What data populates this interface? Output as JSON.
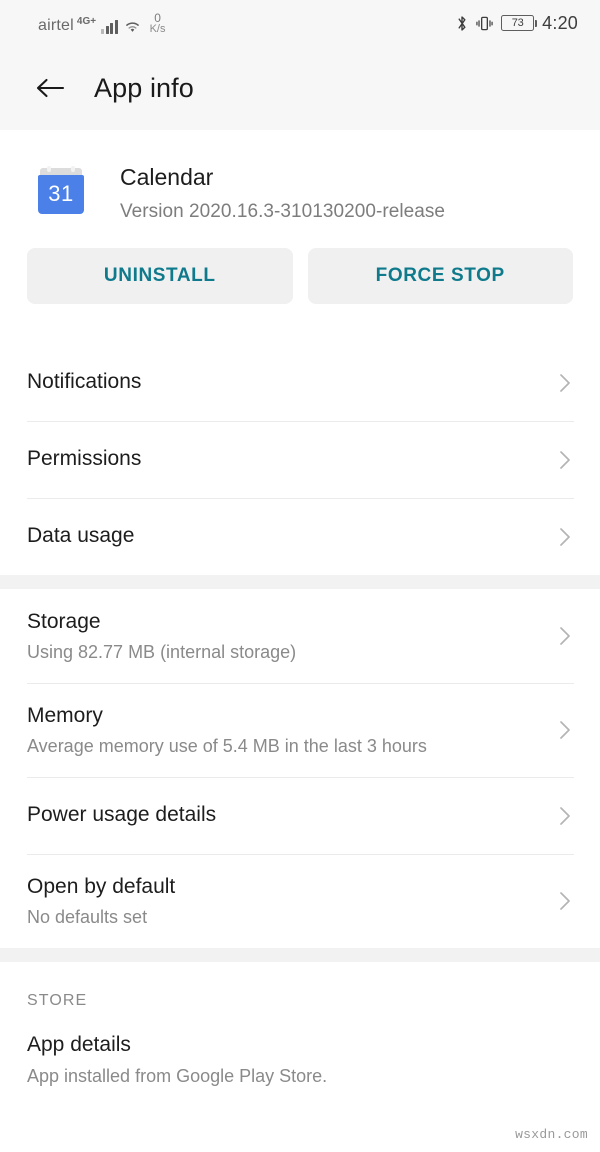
{
  "statusbar": {
    "carrier": "airtel",
    "network_type": "4G+",
    "data_rate_value": "0",
    "data_rate_unit": "K/s",
    "battery_percent": "73",
    "time": "4:20",
    "icons": [
      "signal-bars-icon",
      "wifi-icon",
      "bluetooth-icon",
      "vibrate-icon",
      "battery-icon"
    ]
  },
  "appbar": {
    "back_label": "back-arrow",
    "title": "App info"
  },
  "app": {
    "icon_day": "31",
    "name": "Calendar",
    "version": "Version 2020.16.3-310130200-release"
  },
  "actions": {
    "uninstall": "UNINSTALL",
    "force_stop": "FORCE STOP"
  },
  "groups": [
    {
      "rows": [
        {
          "title": "Notifications",
          "subtitle": ""
        },
        {
          "title": "Permissions",
          "subtitle": ""
        },
        {
          "title": "Data usage",
          "subtitle": ""
        }
      ]
    },
    {
      "rows": [
        {
          "title": "Storage",
          "subtitle": "Using 82.77 MB (internal storage)"
        },
        {
          "title": "Memory",
          "subtitle": "Average memory use of 5.4 MB in the last 3 hours"
        },
        {
          "title": "Power usage details",
          "subtitle": ""
        },
        {
          "title": "Open by default",
          "subtitle": "No defaults set"
        }
      ]
    }
  ],
  "store": {
    "section_label": "STORE",
    "title": "App details",
    "subtitle": "App installed from Google Play Store."
  },
  "watermark": "wsxdn.com",
  "colors": {
    "accent_teal": "#0f7a8c",
    "calendar_blue": "#4a80e8",
    "band_gray": "#f2f2f2",
    "bar_gray": "#f7f7f7"
  }
}
